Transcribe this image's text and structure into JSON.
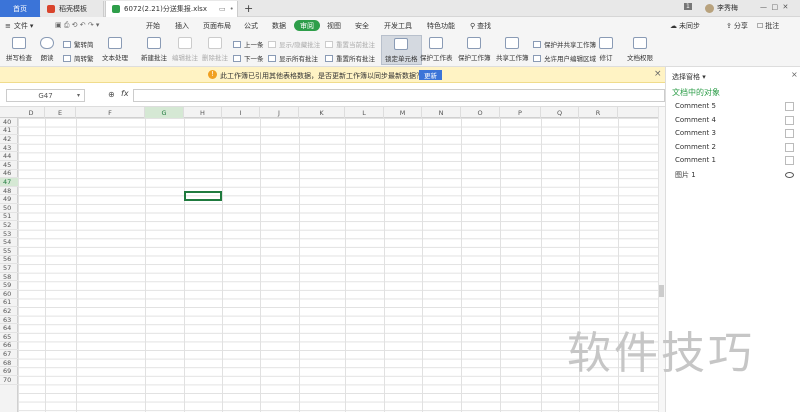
{
  "titlebar": {
    "home_tab": "首页",
    "template_tab": "稻壳模板",
    "file_tab": "6072(2.21)分送集报.xlsx",
    "plus": "+",
    "user_badge": "1",
    "user_name": "李秀梅"
  },
  "menubar": {
    "file": "文件",
    "items": [
      "开始",
      "插入",
      "页面布局",
      "公式",
      "数据",
      "审阅",
      "视图",
      "安全",
      "开发工具",
      "特色功能"
    ],
    "search": "查找",
    "right": [
      "未同步",
      "分享",
      "批注"
    ]
  },
  "ribbon": {
    "spellcheck": "拼写检查",
    "read_aloud": "朗读",
    "trad_simp": "繁转简",
    "simp_trad": "简转繁",
    "text_process": "文本处理",
    "new_comment": "新建批注",
    "edit_comment": "编辑批注",
    "delete_comment": "删除批注",
    "prev": "上一条",
    "next": "下一条",
    "show_hide_comment": "显示/隐藏批注",
    "show_all": "显示所有批注",
    "reset_current": "重置当前批注",
    "reset_all": "重置所有批注",
    "lock_cell": "锁定单元格",
    "protect_sheet": "保护工作表",
    "protect_book": "保护工作簿",
    "share_book": "共享工作簿",
    "protect_share": "保护并共享工作簿",
    "allow_edit": "允许用户编辑区域",
    "track": "修订",
    "doc_rights": "文档权限"
  },
  "notice": {
    "text": "此工作簿已引用其他表格数据，是否更新工作簿以同步最新数据？",
    "update": "更新",
    "close": "×"
  },
  "formula_bar": {
    "cell_ref": "G47",
    "fx": "fx",
    "value": ""
  },
  "sheet": {
    "columns": [
      "D",
      "E",
      "F",
      "G",
      "H",
      "I",
      "J",
      "K",
      "L",
      "M",
      "N",
      "O",
      "P",
      "Q",
      "R"
    ],
    "rows": [
      "40",
      "41",
      "42",
      "43",
      "44",
      "45",
      "46",
      "47",
      "48",
      "49",
      "50",
      "51",
      "52",
      "53",
      "54",
      "55",
      "56",
      "57",
      "58",
      "59",
      "60",
      "61",
      "62",
      "63",
      "64",
      "65",
      "66",
      "67",
      "68",
      "69",
      "70"
    ],
    "selected_cell": "G47"
  },
  "pane": {
    "header": "选择窗格",
    "title": "文档中的对象",
    "items": [
      "Comment 5",
      "Comment 4",
      "Comment 3",
      "Comment 2",
      "Comment 1",
      "图片 1"
    ]
  },
  "watermark": "软件技巧",
  "colors": {
    "accent": "#2e9e4a",
    "home_tab": "#3b74d8",
    "notice_bg": "#fff3c4"
  }
}
